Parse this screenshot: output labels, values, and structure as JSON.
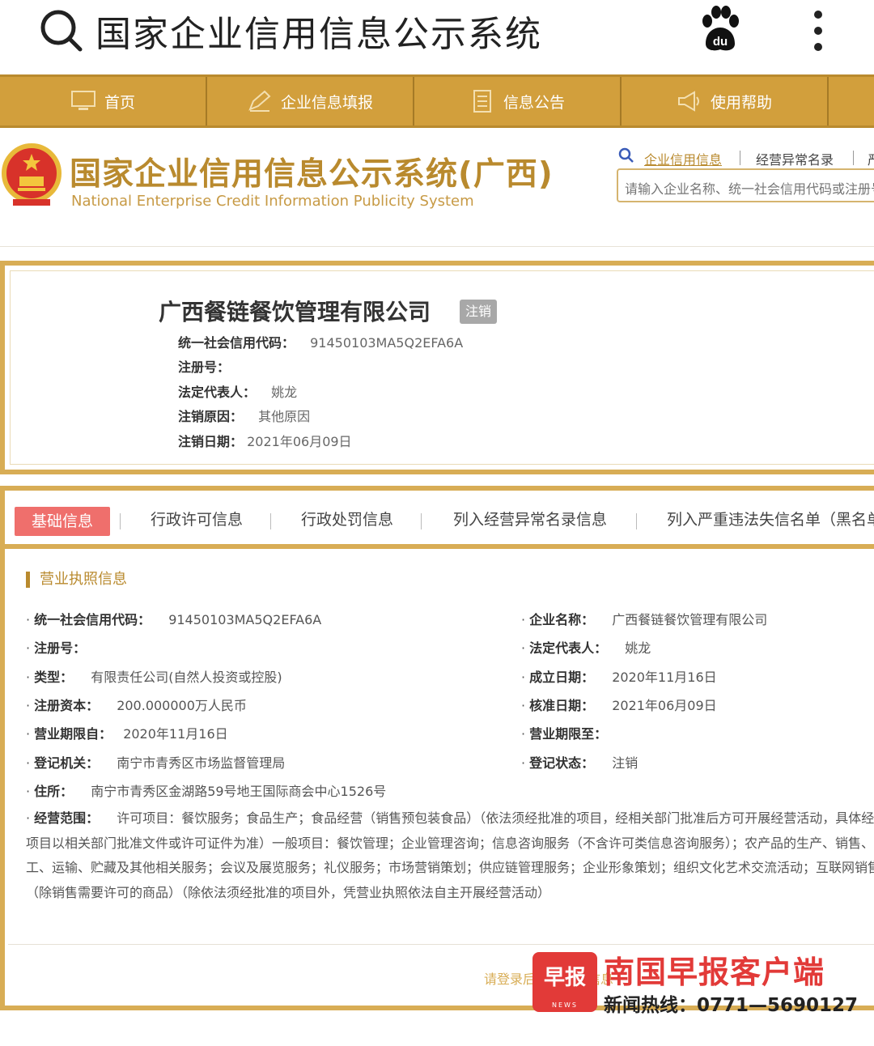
{
  "topbar": {
    "query": "国家企业信用信息公示系统"
  },
  "nav": {
    "items": [
      {
        "label": "首页",
        "icon": "monitor-icon"
      },
      {
        "label": "企业信息填报",
        "icon": "edit-icon"
      },
      {
        "label": "信息公告",
        "icon": "document-icon"
      },
      {
        "label": "使用帮助",
        "icon": "megaphone-icon"
      }
    ]
  },
  "header": {
    "brand_cn": "国家企业信用信息公示系统(广西)",
    "brand_en": "National Enterprise Credit Information Publicity System",
    "links": [
      "企业信用信息",
      "经营异常名录",
      "严"
    ],
    "search_placeholder": "请输入企业名称、统一社会信用代码或注册号"
  },
  "company": {
    "name": "广西餐链餐饮管理有限公司",
    "status": "注销",
    "summary": [
      {
        "label": "统一社会信用代码：",
        "value": "91450103MA5Q2EFA6A"
      },
      {
        "label": "注册号：",
        "value": ""
      },
      {
        "label": "法定代表人：",
        "value": "姚龙"
      },
      {
        "label": "注销原因：",
        "value": "其他原因"
      },
      {
        "label": "注销日期：",
        "value": "2021年06月09日"
      }
    ]
  },
  "tabs": [
    "基础信息",
    "行政许可信息",
    "行政处罚信息",
    "列入经营异常名录信息",
    "列入严重违法失信名单（黑名单）"
  ],
  "license": {
    "title": "营业执照信息",
    "left": [
      {
        "label": "统一社会信用代码：",
        "value": "91450103MA5Q2EFA6A"
      },
      {
        "label": "注册号：",
        "value": ""
      },
      {
        "label": "类型：",
        "value": "有限责任公司(自然人投资或控股)"
      },
      {
        "label": "注册资本：",
        "value": "200.000000万人民币"
      },
      {
        "label": "营业期限自：",
        "value": "2020年11月16日"
      },
      {
        "label": "登记机关：",
        "value": "南宁市青秀区市场监督管理局"
      },
      {
        "label": "住所：",
        "value": "南宁市青秀区金湖路59号地王国际商会中心1526号"
      }
    ],
    "right": [
      {
        "label": "企业名称：",
        "value": "广西餐链餐饮管理有限公司"
      },
      {
        "label": "法定代表人：",
        "value": "姚龙"
      },
      {
        "label": "成立日期：",
        "value": "2020年11月16日"
      },
      {
        "label": "核准日期：",
        "value": "2021年06月09日"
      },
      {
        "label": "营业期限至：",
        "value": ""
      },
      {
        "label": "登记状态：",
        "value": "注销"
      }
    ],
    "scope_label": "经营范围：",
    "scope_value": "许可项目：餐饮服务；食品生产；食品经营（销售预包装食品）（依法须经批准的项目，经相关部门批准后方可开展经营活动，具体经营项目以相关部门批准文件或许可证件为准）一般项目：餐饮管理；企业管理咨询；信息咨询服务（不含许可类信息咨询服务）；农产品的生产、销售、加工、运输、贮藏及其他相关服务；会议及展览服务；礼仪服务；市场营销策划；供应链管理服务；企业形象策划；组织文化艺术交流活动；互联网销售（除销售需要许可的商品）（除依法须经批准的项目外，凭营业执照依法自主开展经营活动）"
  },
  "footer": {
    "login_hint": "请登录后查看更多信息"
  },
  "watermark": {
    "logo_text": "早报",
    "logo_sub": "NEWS",
    "title": "南国早报客户端",
    "hotline": "新闻热线：0771—5690127"
  },
  "colors": {
    "gold": "#d29f3c",
    "gold_border": "#d8ad55",
    "tab_active": "#ef6f6c",
    "badge": "#a8a8a8",
    "watermark_red": "#e23a38"
  }
}
